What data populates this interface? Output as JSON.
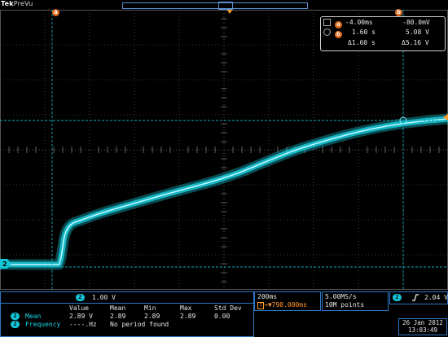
{
  "header": {
    "brand_tek": "Tek",
    "brand_mode": "PreVu"
  },
  "cursors": {
    "a_label": "a",
    "b_label": "b"
  },
  "readout": {
    "row_a": {
      "t": "-4.00ms",
      "v": "-80.0mV"
    },
    "row_b": {
      "t": "1.60 s",
      "v": "5.08 V"
    },
    "row_delta": {
      "t": "Δ1.60 s",
      "v": "Δ5.16 V"
    }
  },
  "channel": {
    "number": "2",
    "scale": "1.00 V"
  },
  "measurements": {
    "headers": [
      "Value",
      "Mean",
      "Min",
      "Max",
      "Std Dev"
    ],
    "rows": [
      {
        "ch": "2",
        "name": "Mean",
        "cells": [
          "2.89 V",
          "2.89",
          "2.89",
          "2.89",
          "0.00"
        ]
      },
      {
        "ch": "2",
        "name": "Frequency",
        "cells": [
          "----.Hz",
          "No period found"
        ]
      }
    ]
  },
  "horizontal": {
    "scale": "200ms",
    "position": "▼798.000ms"
  },
  "acquisition": {
    "rate": "5.00MS/s",
    "length": "10M points"
  },
  "trigger": {
    "channel": "2",
    "slope_icon": "rising-edge-icon",
    "level": "2.04 V"
  },
  "datetime": {
    "date": "26 Jan  2012",
    "time": "13:03:49"
  },
  "colors": {
    "trace": "#17d7e8",
    "cursor": "#13a8b8",
    "frame": "#2c78c8",
    "accent": "#e06a1a"
  }
}
